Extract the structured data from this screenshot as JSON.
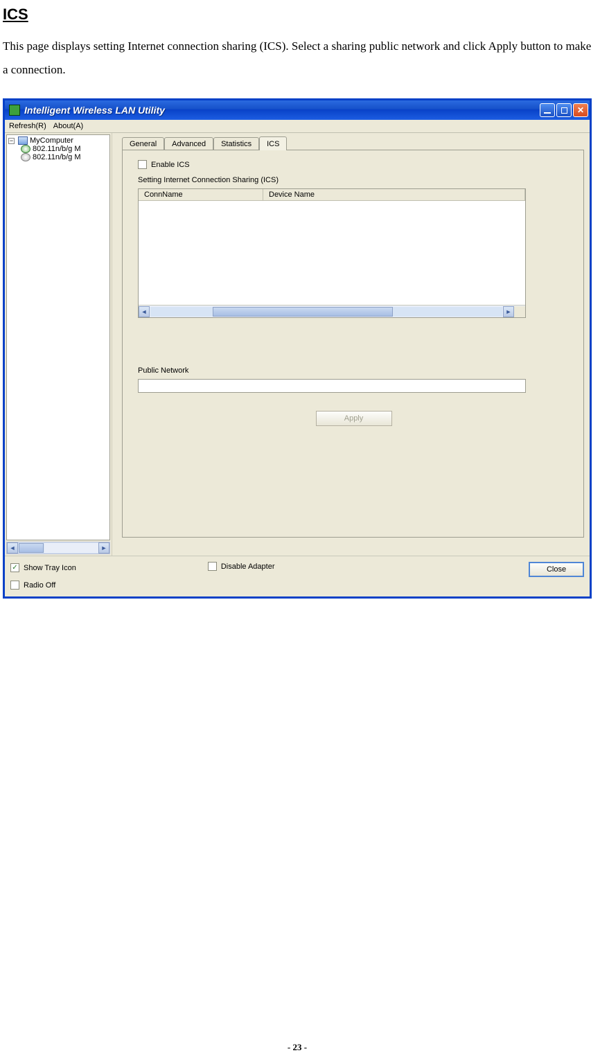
{
  "doc": {
    "section_title": "ICS",
    "body_text": "This page displays setting Internet connection sharing (ICS). Select a sharing public network and click Apply button to make a connection.",
    "page_number": "- 23 -"
  },
  "window": {
    "title": "Intelligent Wireless LAN Utility",
    "menu": {
      "refresh": "Refresh(R)",
      "about": "About(A)"
    },
    "tree": {
      "root": "MyComputer",
      "items": [
        "802.11n/b/g M",
        "802.11n/b/g M"
      ]
    },
    "tabs": {
      "general": "General",
      "advanced": "Advanced",
      "statistics": "Statistics",
      "ics": "ICS"
    },
    "ics_tab": {
      "enable_label": "Enable ICS",
      "setting_label": "Setting Internet Connection Sharing (ICS)",
      "col_conn": "ConnName",
      "col_dev": "Device Name",
      "public_network_label": "Public Network",
      "public_network_value": "",
      "apply_label": "Apply"
    },
    "bottom": {
      "show_tray": "Show Tray Icon",
      "radio_off": "Radio Off",
      "disable_adapter": "Disable Adapter",
      "close": "Close"
    }
  }
}
